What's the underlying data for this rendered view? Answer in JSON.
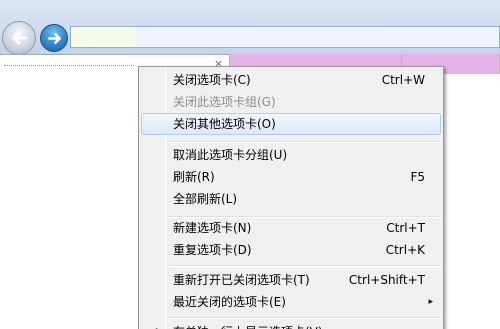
{
  "menu": {
    "items": [
      {
        "label": "关闭选项卡(C)",
        "shortcut": "Ctrl+W"
      },
      {
        "label": "关闭此选项卡组(G)",
        "shortcut": ""
      },
      {
        "label": "关闭其他选项卡(O)",
        "shortcut": ""
      },
      {
        "label": "取消此选项卡分组(U)",
        "shortcut": ""
      },
      {
        "label": "刷新(R)",
        "shortcut": "F5"
      },
      {
        "label": "全部刷新(L)",
        "shortcut": ""
      },
      {
        "label": "新建选项卡(N)",
        "shortcut": "Ctrl+T"
      },
      {
        "label": "重复选项卡(D)",
        "shortcut": "Ctrl+K"
      },
      {
        "label": "重新打开已关闭选项卡(T)",
        "shortcut": "Ctrl+Shift+T"
      },
      {
        "label": "最近关闭的选项卡(E)",
        "shortcut": ""
      },
      {
        "label": "在单独一行上显示选项卡(V)",
        "shortcut": ""
      }
    ],
    "submenu_arrow": "▸",
    "check_mark": "✔"
  },
  "tab": {
    "close_glyph": "×"
  },
  "colors": {
    "tab_group": "#e6b3e6",
    "menu_highlight": "#dbe8f8"
  }
}
